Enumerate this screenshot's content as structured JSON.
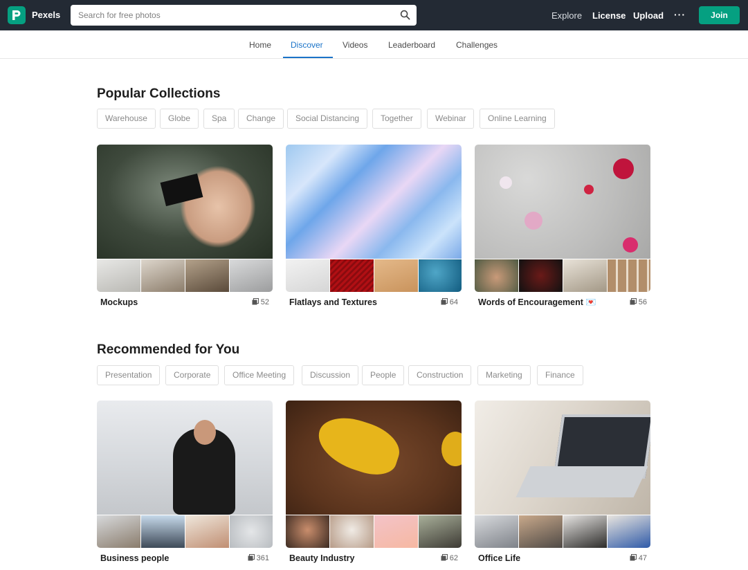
{
  "topbar": {
    "brand": "Pexels",
    "search_placeholder": "Search for free photos",
    "explore": "Explore",
    "license": "License",
    "upload": "Upload",
    "more": "···",
    "join": "Join"
  },
  "tabs": [
    {
      "label": "Home",
      "active": false
    },
    {
      "label": "Discover",
      "active": true
    },
    {
      "label": "Videos",
      "active": false
    },
    {
      "label": "Leaderboard",
      "active": false
    },
    {
      "label": "Challenges",
      "active": false
    }
  ],
  "popular": {
    "title": "Popular Collections",
    "chips": [
      "Warehouse",
      "Globe",
      "Spa",
      "Change",
      "Social Distancing",
      "Together",
      "Webinar",
      "Online Learning"
    ],
    "cards": [
      {
        "name": "Mockups",
        "count": "52"
      },
      {
        "name": "Flatlays and Textures",
        "count": "64"
      },
      {
        "name": "Words of Encouragement 💌",
        "count": "56"
      }
    ]
  },
  "recommended": {
    "title": "Recommended for You",
    "chips": [
      "Presentation",
      "Corporate",
      "Office Meeting",
      "Discussion",
      "People",
      "Construction",
      "Marketing",
      "Finance"
    ],
    "cards": [
      {
        "name": "Business people",
        "count": "361"
      },
      {
        "name": "Beauty Industry",
        "count": "62"
      },
      {
        "name": "Office Life",
        "count": "47"
      }
    ]
  },
  "colors": {
    "topbar": "#232a34",
    "accent": "#05a081",
    "active_tab": "#1a73c8"
  },
  "icons": {
    "logo": "pexels-logo-icon",
    "search": "search-icon",
    "collection_count": "photo-stack-icon"
  }
}
